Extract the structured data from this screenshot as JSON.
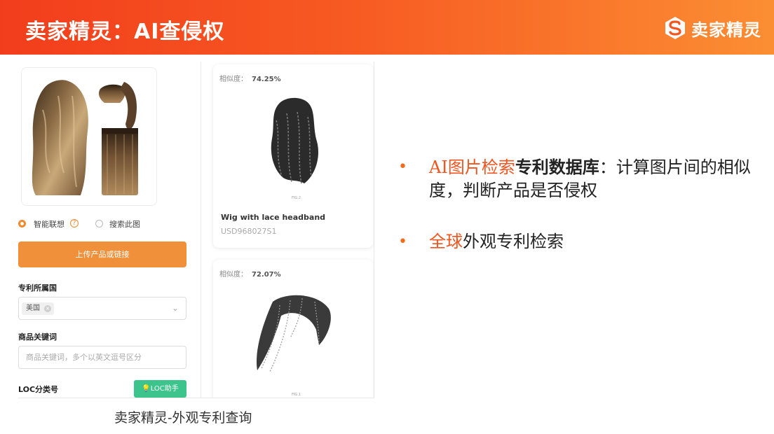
{
  "header": {
    "title": "卖家精灵：AI查侵权",
    "brand_name": "卖家精灵",
    "gradient_colors": [
      "#f23d1c",
      "#fb8e33"
    ]
  },
  "screenshot": {
    "search_mode": {
      "option_smart": "智能联想",
      "option_this_image": "搜索此图",
      "selected": "智能联想"
    },
    "upload_button": "上传产品或链接",
    "patent_country": {
      "label": "专利所属国",
      "tag": "美国"
    },
    "keywords": {
      "label": "商品关键词",
      "placeholder": "商品关键词，多个以英文逗号区分"
    },
    "loc": {
      "label": "LOC分类号",
      "assistant_button": "LOC助手"
    },
    "results": [
      {
        "similarity_label": "相似度：",
        "similarity": "74.25%",
        "figure_caption": "FIG.2",
        "name": "Wig with lace headband",
        "patent_id": "USD968027S1"
      },
      {
        "similarity_label": "相似度：",
        "similarity": "72.07%",
        "figure_caption": "FIG.1"
      }
    ]
  },
  "caption": "卖家精灵-外观专利查询",
  "bullets": [
    {
      "highlight": "AI图片检索",
      "bold": "专利数据库",
      "rest": "：计算图片间的相似度，判断产品是否侵权"
    },
    {
      "highlight": "全球",
      "rest": "外观专利检索"
    }
  ],
  "colors": {
    "accent": "#f0541f",
    "upload_button": "#f0903a",
    "loc_button": "#3cc48c"
  }
}
